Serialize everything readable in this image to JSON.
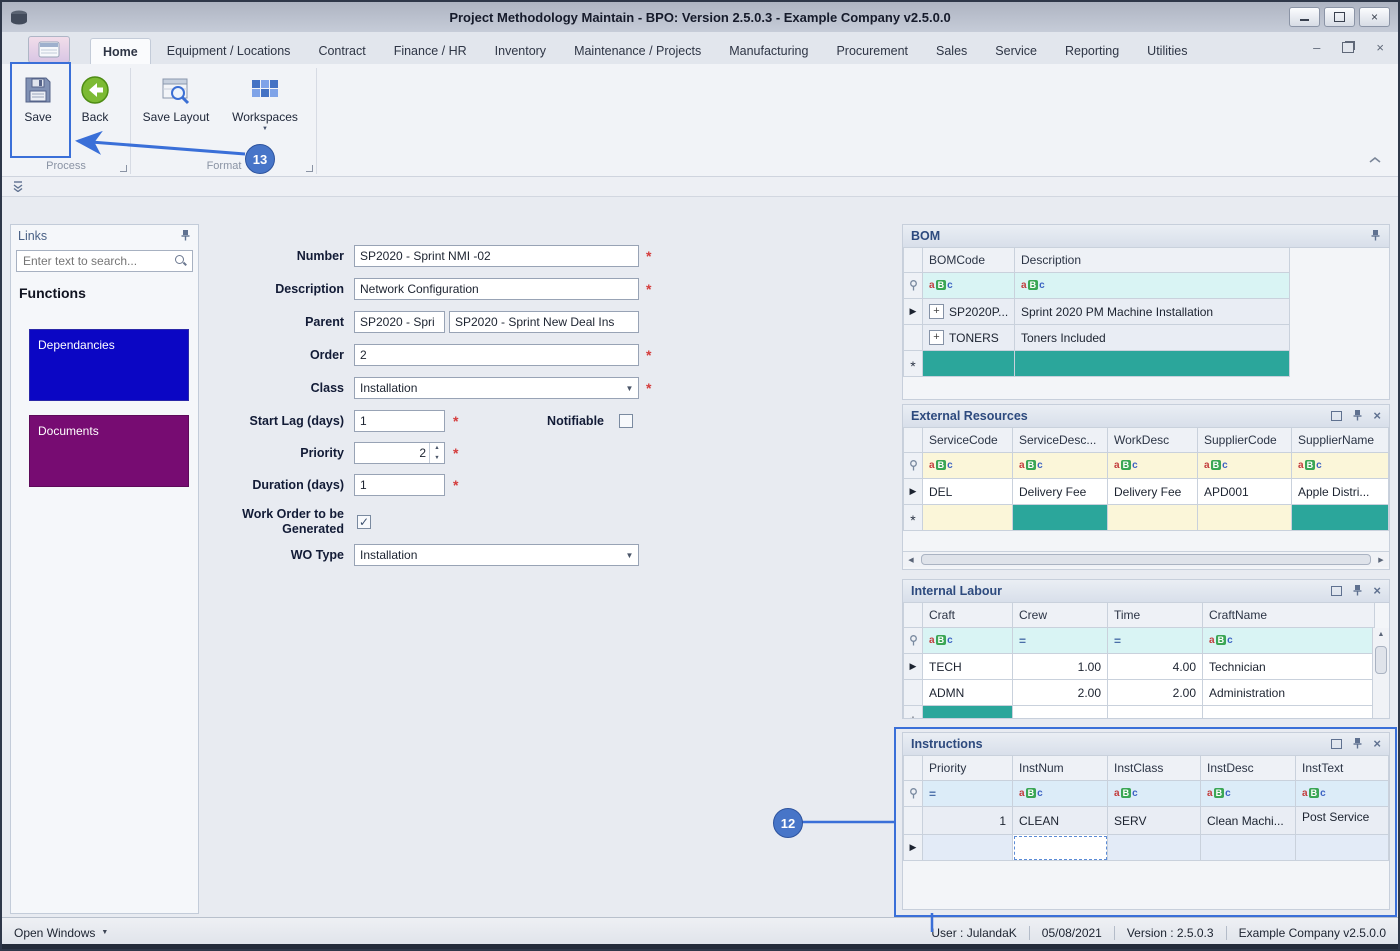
{
  "icons": {
    "abc_a": "a",
    "abc_b": "B",
    "abc_c": "c",
    "eq": "=",
    "plus": "+",
    "check": "✓",
    "dropdown": "▼",
    "spin_up": "▲",
    "spin_down": "▼",
    "row_current": "▶",
    "row_new": "*",
    "close": "×",
    "left": "◀",
    "right": "▶",
    "up": "▲"
  },
  "titlebar": {
    "title": "Project Methodology Maintain - BPO: Version 2.5.0.3 - Example Company v2.5.0.0"
  },
  "ribbon": {
    "tabs": [
      "Home",
      "Equipment / Locations",
      "Contract",
      "Finance / HR",
      "Inventory",
      "Maintenance / Projects",
      "Manufacturing",
      "Procurement",
      "Sales",
      "Service",
      "Reporting",
      "Utilities"
    ],
    "buttons": {
      "save": "Save",
      "back": "Back",
      "save_layout": "Save Layout",
      "workspaces": "Workspaces"
    },
    "groups": {
      "process": "Process",
      "format": "Format"
    }
  },
  "links": {
    "title": "Links",
    "search_placeholder": "Enter text to search...",
    "heading": "Functions",
    "buttons": [
      {
        "label": "Dependancies",
        "color": "#0b06c4"
      },
      {
        "label": "Documents",
        "color": "#770c72"
      }
    ]
  },
  "form": {
    "required_marker": "*",
    "number_label": "Number",
    "number_value": "SP2020 - Sprint NMI -02",
    "description_label": "Description",
    "description_value": "Network Configuration",
    "parent_label": "Parent",
    "parent_code": "SP2020 - Spri",
    "parent_desc": "SP2020 - Sprint New Deal Ins",
    "order_label": "Order",
    "order_value": "2",
    "class_label": "Class",
    "class_value": "Installation",
    "start_lag_label": "Start Lag (days)",
    "start_lag_value": "1",
    "notifiable_label": "Notifiable",
    "priority_label": "Priority",
    "priority_value": "2",
    "duration_label": "Duration (days)",
    "duration_value": "1",
    "wo_generated_label": "Work Order to be Generated",
    "wo_type_label": "WO Type",
    "wo_type_value": "Installation"
  },
  "bom": {
    "title": "BOM",
    "columns": [
      "BOMCode",
      "Description"
    ],
    "rows": [
      {
        "code": "SP2020P...",
        "desc": "Sprint 2020 PM Machine Installation"
      },
      {
        "code": "TONERS",
        "desc": "Toners Included"
      }
    ]
  },
  "external_resources": {
    "title": "External Resources",
    "columns": [
      "ServiceCode",
      "ServiceDesc...",
      "WorkDesc",
      "SupplierCode",
      "SupplierName"
    ],
    "rows": [
      [
        "DEL",
        "Delivery Fee",
        "Delivery Fee",
        "APD001",
        "Apple Distri..."
      ]
    ]
  },
  "internal_labour": {
    "title": "Internal Labour",
    "columns": [
      "Craft",
      "Crew",
      "Time",
      "CraftName"
    ],
    "rows": [
      [
        "TECH",
        "1.00",
        "4.00",
        "Technician"
      ],
      [
        "ADMN",
        "2.00",
        "2.00",
        "Administration"
      ]
    ]
  },
  "instructions": {
    "title": "Instructions",
    "columns": [
      "Priority",
      "InstNum",
      "InstClass",
      "InstDesc",
      "InstText"
    ],
    "rows": [
      [
        "1",
        "CLEAN",
        "SERV",
        "Clean Machi...",
        "Post Service"
      ]
    ]
  },
  "annotations": {
    "badge_12": "12",
    "badge_13": "13"
  },
  "statusbar": {
    "open_windows": "Open Windows",
    "user": "User : JulandaK",
    "date": "05/08/2021",
    "version": "Version : 2.5.0.3",
    "company": "Example Company v2.5.0.0"
  }
}
